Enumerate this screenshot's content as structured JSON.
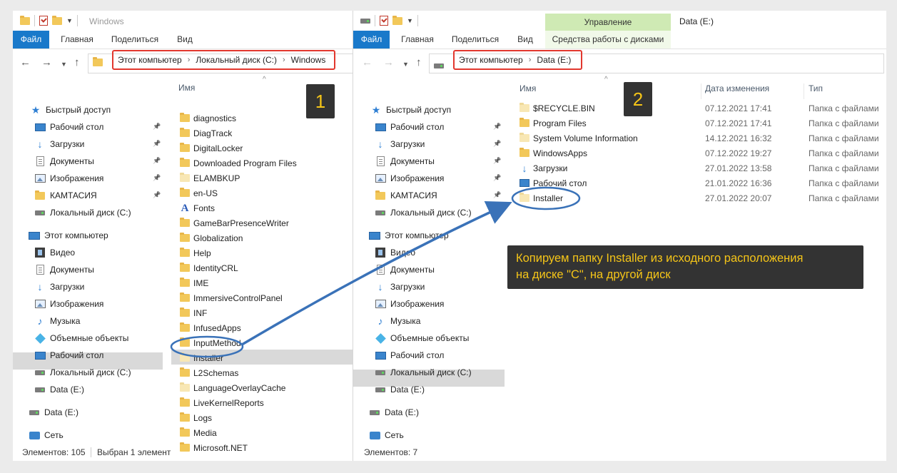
{
  "win1": {
    "title": "Windows",
    "ribbon_tabs": [
      "Файл",
      "Главная",
      "Поделиться",
      "Вид"
    ],
    "breadcrumb": [
      "Этот компьютер",
      "Локальный диск (C:)",
      "Windows"
    ],
    "column_name": "Имя",
    "badge": "1",
    "tree": [
      {
        "label": "Быстрый доступ",
        "icon": "star-icon"
      },
      {
        "label": "Рабочий стол",
        "icon": "desktop-icon",
        "pinned": true
      },
      {
        "label": "Загрузки",
        "icon": "download-icon",
        "pinned": true
      },
      {
        "label": "Документы",
        "icon": "document-icon",
        "pinned": true
      },
      {
        "label": "Изображения",
        "icon": "pictures-icon",
        "pinned": true
      },
      {
        "label": "КАМТАСИЯ",
        "icon": "folder-icon",
        "pinned": true
      },
      {
        "label": "Локальный диск (C:)",
        "icon": "drive-icon"
      },
      {
        "label": "Этот компьютер",
        "icon": "computer-icon"
      },
      {
        "label": "Видео",
        "icon": "video-icon"
      },
      {
        "label": "Документы",
        "icon": "document-icon"
      },
      {
        "label": "Загрузки",
        "icon": "download-icon"
      },
      {
        "label": "Изображения",
        "icon": "pictures-icon"
      },
      {
        "label": "Музыка",
        "icon": "music-icon"
      },
      {
        "label": "Объемные объекты",
        "icon": "3d-objects-icon"
      },
      {
        "label": "Рабочий стол",
        "icon": "desktop-icon"
      },
      {
        "label": "Локальный диск (C:)",
        "icon": "drive-icon",
        "selected": true
      },
      {
        "label": "Data (E:)",
        "icon": "drive-icon"
      },
      {
        "label": "Data (E:)",
        "icon": "drive-icon"
      },
      {
        "label": "Сеть",
        "icon": "network-icon"
      }
    ],
    "files": [
      {
        "name": "diagnostics",
        "icon": "folder-icon"
      },
      {
        "name": "DiagTrack",
        "icon": "folder-icon"
      },
      {
        "name": "DigitalLocker",
        "icon": "folder-icon"
      },
      {
        "name": "Downloaded Program Files",
        "icon": "folder-icon"
      },
      {
        "name": "ELAMBKUP",
        "icon": "folder-pale-icon"
      },
      {
        "name": "en-US",
        "icon": "folder-icon"
      },
      {
        "name": "Fonts",
        "icon": "fonts-icon"
      },
      {
        "name": "GameBarPresenceWriter",
        "icon": "folder-icon"
      },
      {
        "name": "Globalization",
        "icon": "folder-icon"
      },
      {
        "name": "Help",
        "icon": "folder-icon"
      },
      {
        "name": "IdentityCRL",
        "icon": "folder-icon"
      },
      {
        "name": "IME",
        "icon": "folder-icon"
      },
      {
        "name": "ImmersiveControlPanel",
        "icon": "folder-icon"
      },
      {
        "name": "INF",
        "icon": "folder-icon"
      },
      {
        "name": "InfusedApps",
        "icon": "folder-icon"
      },
      {
        "name": "InputMethod",
        "icon": "folder-icon"
      },
      {
        "name": "Installer",
        "icon": "folder-pale-icon",
        "selected": true
      },
      {
        "name": "L2Schemas",
        "icon": "folder-icon"
      },
      {
        "name": "LanguageOverlayCache",
        "icon": "folder-pale-icon"
      },
      {
        "name": "LiveKernelReports",
        "icon": "folder-icon"
      },
      {
        "name": "Logs",
        "icon": "folder-icon"
      },
      {
        "name": "Media",
        "icon": "folder-icon"
      },
      {
        "name": "Microsoft.NET",
        "icon": "folder-icon"
      }
    ],
    "status_count": "Элементов: 105",
    "status_selected": "Выбран 1 элемент"
  },
  "win2": {
    "title": "Data (E:)",
    "ribbon_tabs": [
      "Файл",
      "Главная",
      "Поделиться",
      "Вид"
    ],
    "manage_header": "Управление",
    "manage_tab": "Средства работы с дисками",
    "breadcrumb": [
      "Этот компьютер",
      "Data (E:)"
    ],
    "columns": {
      "name": "Имя",
      "date": "Дата изменения",
      "type": "Тип"
    },
    "badge": "2",
    "tree": [
      {
        "label": "Быстрый доступ",
        "icon": "star-icon"
      },
      {
        "label": "Рабочий стол",
        "icon": "desktop-icon",
        "pinned": true
      },
      {
        "label": "Загрузки",
        "icon": "download-icon",
        "pinned": true
      },
      {
        "label": "Документы",
        "icon": "document-icon",
        "pinned": true
      },
      {
        "label": "Изображения",
        "icon": "pictures-icon",
        "pinned": true
      },
      {
        "label": "КАМТАСИЯ",
        "icon": "folder-icon",
        "pinned": true
      },
      {
        "label": "Локальный диск (C:)",
        "icon": "drive-icon"
      },
      {
        "label": "Этот компьютер",
        "icon": "computer-icon"
      },
      {
        "label": "Видео",
        "icon": "video-icon"
      },
      {
        "label": "Документы",
        "icon": "document-icon"
      },
      {
        "label": "Загрузки",
        "icon": "download-icon"
      },
      {
        "label": "Изображения",
        "icon": "pictures-icon"
      },
      {
        "label": "Музыка",
        "icon": "music-icon"
      },
      {
        "label": "Объемные объекты",
        "icon": "3d-objects-icon"
      },
      {
        "label": "Рабочий стол",
        "icon": "desktop-icon"
      },
      {
        "label": "Локальный диск (C:)",
        "icon": "drive-icon"
      },
      {
        "label": "Data (E:)",
        "icon": "drive-icon",
        "selected": true
      },
      {
        "label": "Data (E:)",
        "icon": "drive-icon"
      },
      {
        "label": "Сеть",
        "icon": "network-icon"
      }
    ],
    "files": [
      {
        "name": "$RECYCLE.BIN",
        "date": "07.12.2021 17:41",
        "type": "Папка с файлами",
        "icon": "folder-pale-icon"
      },
      {
        "name": "Program Files",
        "date": "07.12.2021 17:41",
        "type": "Папка с файлами",
        "icon": "folder-icon"
      },
      {
        "name": "System Volume Information",
        "date": "14.12.2021 16:32",
        "type": "Папка с файлами",
        "icon": "folder-pale-icon"
      },
      {
        "name": "WindowsApps",
        "date": "07.12.2022 19:27",
        "type": "Папка с файлами",
        "icon": "folder-icon"
      },
      {
        "name": "Загрузки",
        "date": "27.01.2022 13:58",
        "type": "Папка с файлами",
        "icon": "download-icon"
      },
      {
        "name": "Рабочий стол",
        "date": "21.01.2022 16:36",
        "type": "Папка с файлами",
        "icon": "desktop-icon"
      },
      {
        "name": "Installer",
        "date": "27.01.2022 20:07",
        "type": "Папка с файлами",
        "icon": "folder-pale-icon"
      }
    ],
    "status_count": "Элементов: 7"
  },
  "callout": {
    "line1": "Копируем папку Installer из исходного расположения",
    "line2": "на диске \"С\", на другой диск"
  },
  "colors": {
    "accent": "#1979ca",
    "highlight_red": "#e2372e",
    "arrow": "#3a72b8",
    "callout_text": "#f5c518"
  }
}
